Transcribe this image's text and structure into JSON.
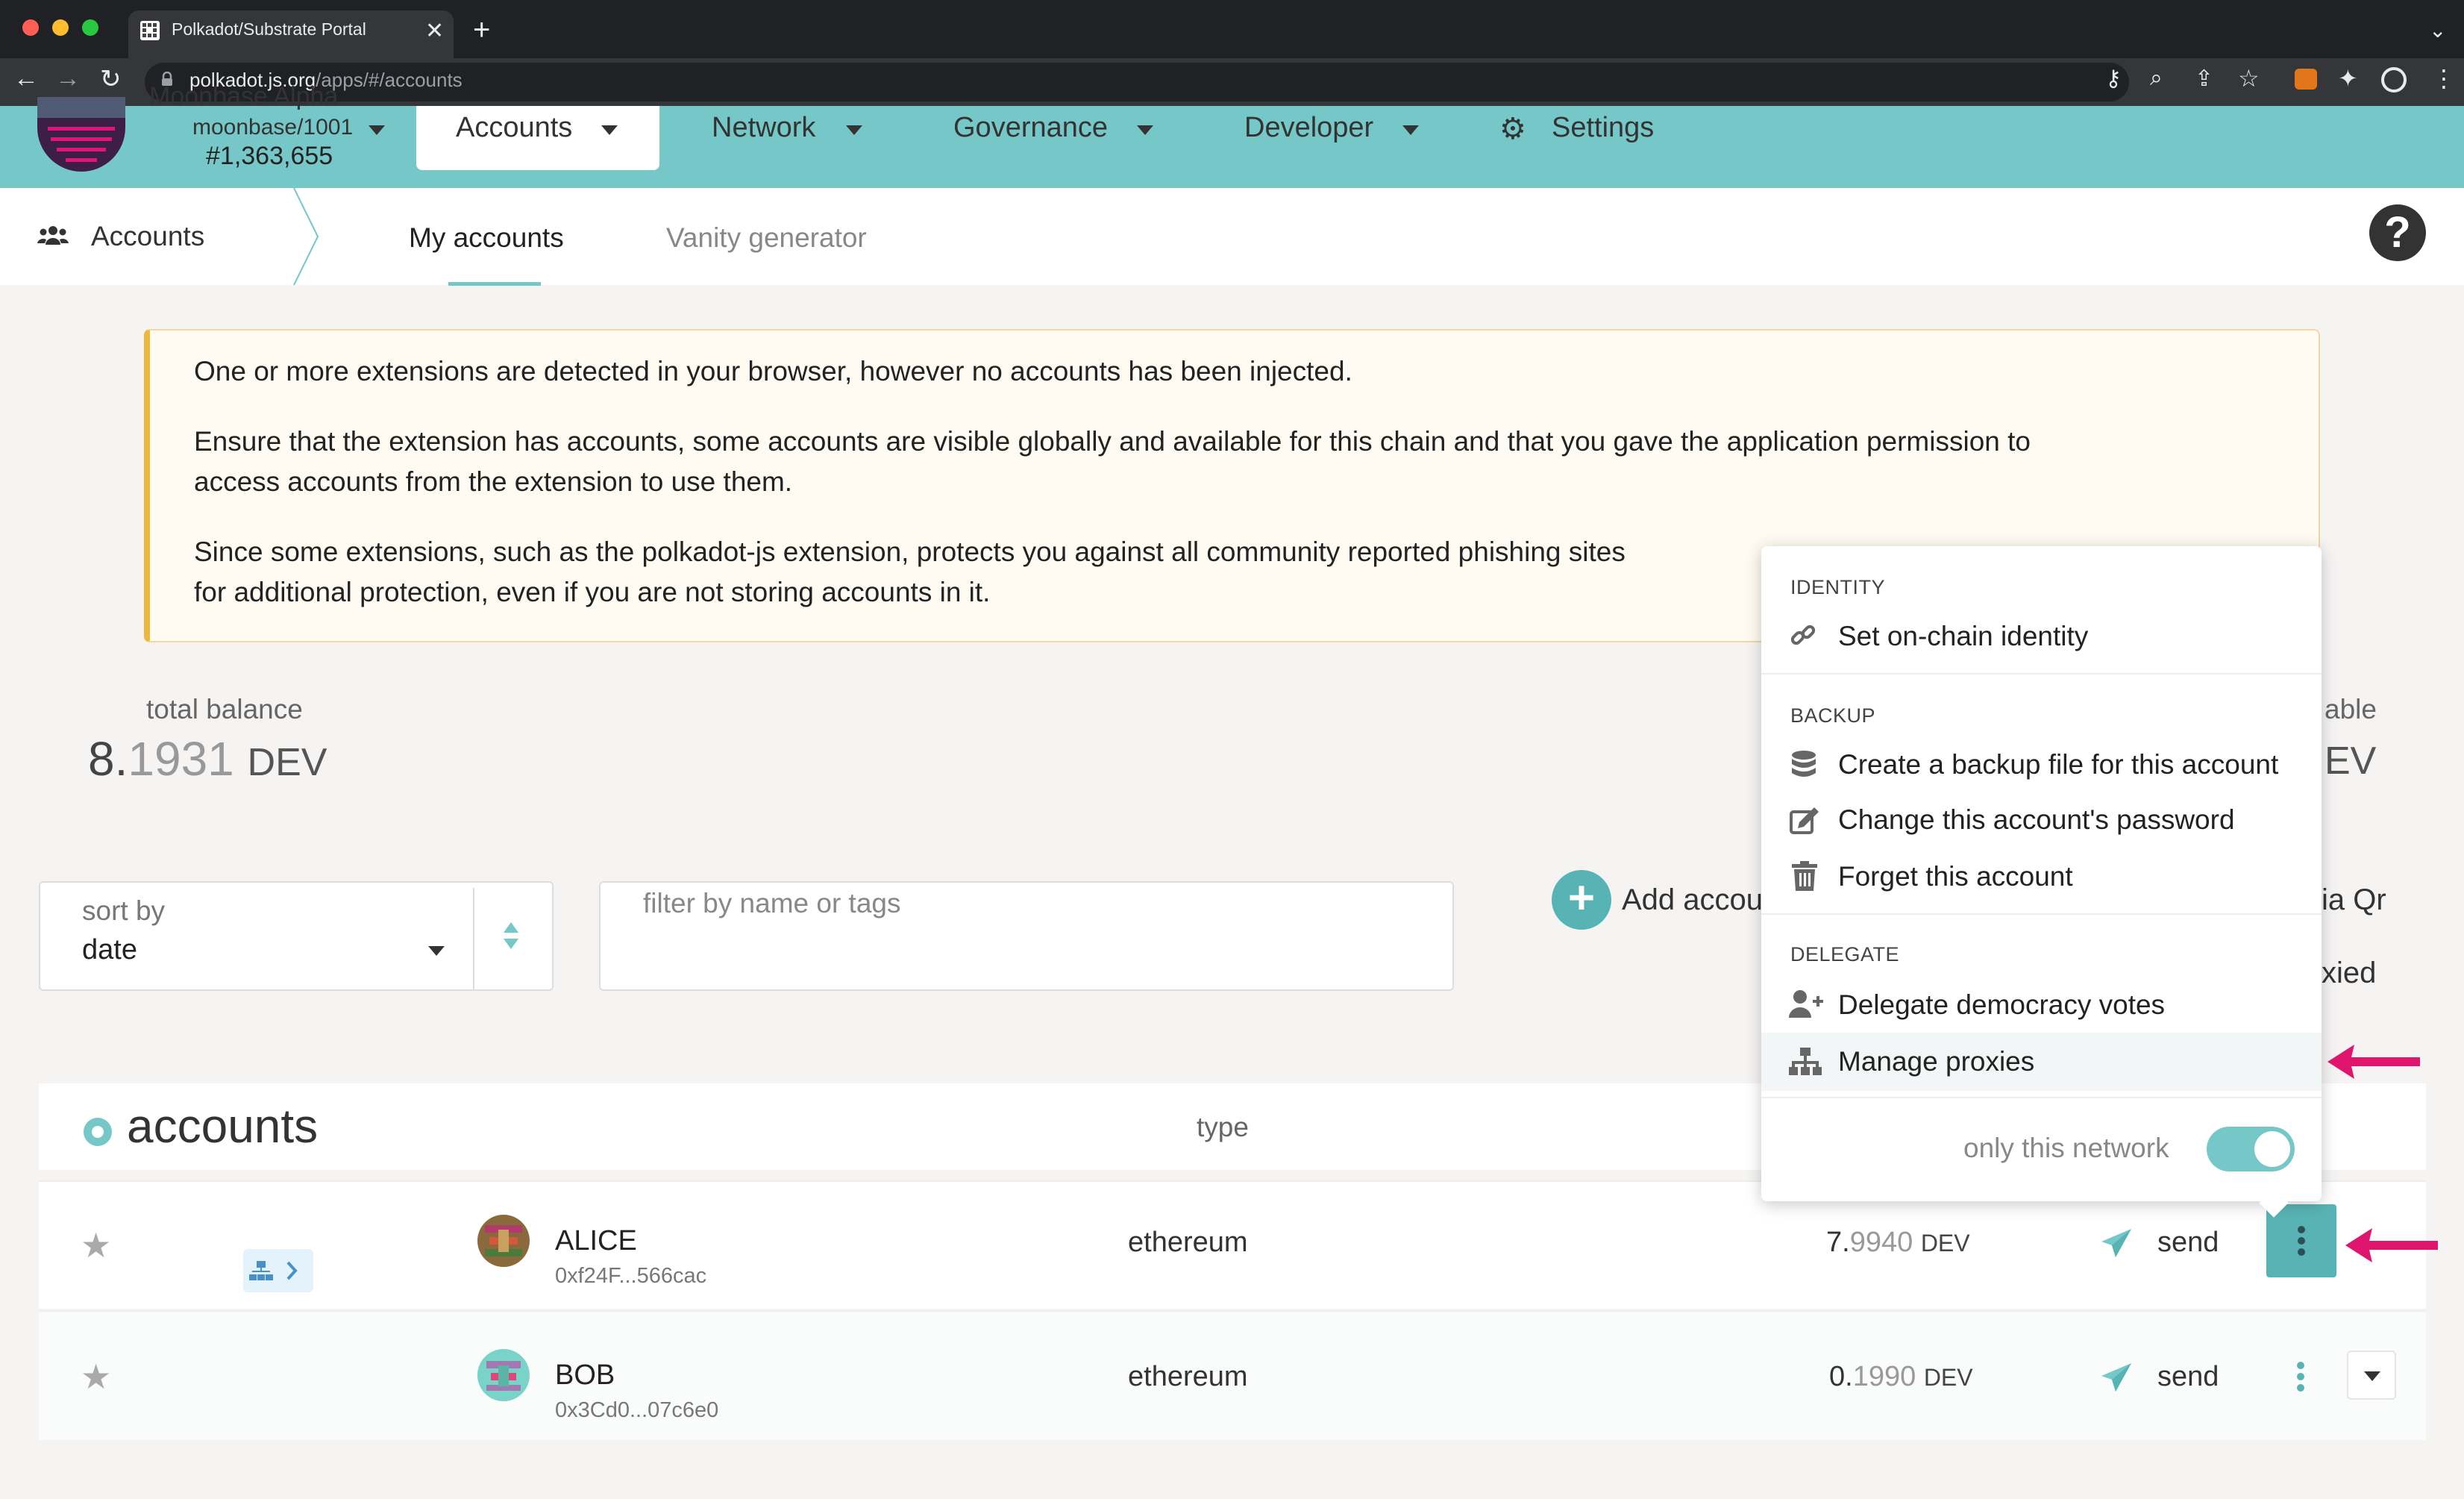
{
  "browser": {
    "tab_title": "Polkadot/Substrate Portal",
    "url_host": "polkadot.js.org",
    "url_path": "/apps/#/accounts"
  },
  "header": {
    "chain_name": "Moonbase Alpha",
    "chain_spec": "moonbase/1001",
    "block_number": "#1,363,655",
    "menu": [
      {
        "label": "Accounts",
        "active": true
      },
      {
        "label": "Network"
      },
      {
        "label": "Governance"
      },
      {
        "label": "Developer"
      },
      {
        "label": "Settings",
        "icon": "gears-icon"
      }
    ]
  },
  "subnav": {
    "title": "Accounts",
    "tabs": [
      {
        "label": "My accounts",
        "active": true
      },
      {
        "label": "Vanity generator"
      }
    ]
  },
  "banner": {
    "line1": "One or more extensions are detected in your browser, however no accounts has been injected.",
    "line2a": "Ensure that the extension has accounts, some accounts are visible globally and available for this chain and that you gave the application permission to",
    "line2b": "access accounts from the extension to use them.",
    "line3a": "Since some extensions, such as the polkadot-js extension, protects you against all community reported phishing sites",
    "line3b": "for additional protection, even if you are not storing accounts in it."
  },
  "summary": {
    "total_balance_label": "total balance",
    "total_balance_int": "8.",
    "total_balance_frac": "1931",
    "unit": "DEV",
    "right_label_fragment": "able",
    "right_value_fragment": "EV"
  },
  "controls": {
    "sort_label": "sort by",
    "sort_value": "date",
    "filter_placeholder": "filter by name or tags",
    "add_account_fragment": "Add accou",
    "via_qr_fragment": "ia Qr",
    "proxied_fragment": "xied"
  },
  "table": {
    "title": "accounts",
    "type_header": "type",
    "rows": [
      {
        "name": "ALICE",
        "address": "0xf24F...566cac",
        "type": "ethereum",
        "balance_int": "7.",
        "balance_frac": "9940",
        "unit": "DEV",
        "send_label": "send"
      },
      {
        "name": "BOB",
        "address": "0x3Cd0...07c6e0",
        "type": "ethereum",
        "balance_int": "0.",
        "balance_frac": "1990",
        "unit": "DEV",
        "send_label": "send"
      }
    ]
  },
  "popup": {
    "sections": [
      {
        "heading": "IDENTITY",
        "items": [
          {
            "label": "Set on-chain identity",
            "icon": "link-icon"
          }
        ]
      },
      {
        "heading": "BACKUP",
        "items": [
          {
            "label": "Create a backup file for this account",
            "icon": "database-icon"
          },
          {
            "label": "Change this account's password",
            "icon": "edit-icon"
          },
          {
            "label": "Forget this account",
            "icon": "trash-icon"
          }
        ]
      },
      {
        "heading": "DELEGATE",
        "items": [
          {
            "label": "Delegate democracy votes",
            "icon": "user-plus-icon"
          },
          {
            "label": "Manage proxies",
            "icon": "sitemap-icon",
            "highlighted": true
          }
        ]
      }
    ],
    "toggle_label": "only this network",
    "toggle_on": true
  },
  "colors": {
    "accent": "#76c8c8",
    "annotation_arrow": "#e0166e",
    "warning_border": "#f0b73e"
  }
}
